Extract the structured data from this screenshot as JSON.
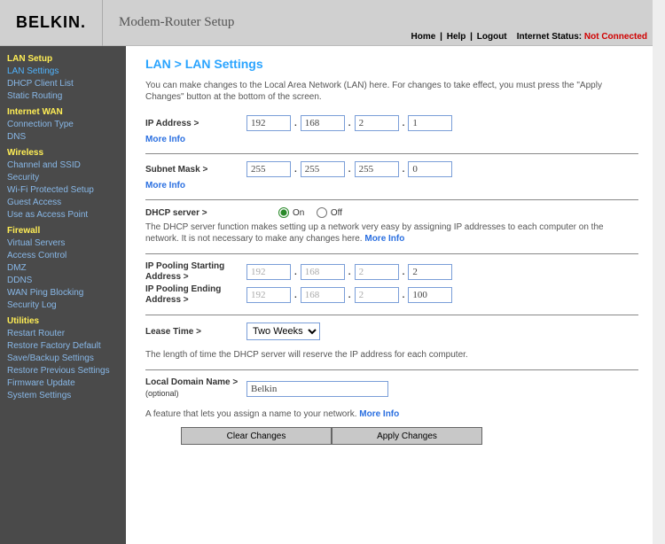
{
  "header": {
    "logo": "BELKIN",
    "product": "Modem-Router Setup",
    "nav": {
      "home": "Home",
      "help": "Help",
      "logout": "Logout"
    },
    "status_label": "Internet Status: ",
    "status_value": "Not Connected"
  },
  "sidebar": {
    "lan_setup": {
      "head": "LAN Setup",
      "items": [
        "LAN Settings",
        "DHCP Client List",
        "Static Routing"
      ]
    },
    "internet_wan": {
      "head": "Internet WAN",
      "items": [
        "Connection Type",
        "DNS"
      ]
    },
    "wireless": {
      "head": "Wireless",
      "items": [
        "Channel and SSID",
        "Security",
        "Wi-Fi Protected Setup",
        "Guest Access",
        "Use as Access Point"
      ]
    },
    "firewall": {
      "head": "Firewall",
      "items": [
        "Virtual Servers",
        "Access Control",
        "DMZ",
        "DDNS",
        "WAN Ping Blocking",
        "Security Log"
      ]
    },
    "utilities": {
      "head": "Utilities",
      "items": [
        "Restart Router",
        "Restore Factory Default",
        "Save/Backup Settings",
        "Restore Previous Settings",
        "Firmware Update",
        "System Settings"
      ]
    }
  },
  "main": {
    "breadcrumb": "LAN > LAN Settings",
    "intro": "You can make changes to the Local Area Network (LAN) here. For changes to take effect, you must press the \"Apply Changes\" button at the bottom of the screen.",
    "more_info": "More Info",
    "ip_address": {
      "label": "IP Address >",
      "octets": [
        "192",
        "168",
        "2",
        "1"
      ]
    },
    "subnet_mask": {
      "label": "Subnet Mask >",
      "octets": [
        "255",
        "255",
        "255",
        "0"
      ]
    },
    "dhcp": {
      "label": "DHCP server >",
      "on": "On",
      "off": "Off",
      "desc": "The DHCP server function makes setting up a network very easy by assigning IP addresses to each computer on the network. It is not necessary to make any changes here. "
    },
    "pool_start": {
      "label": "IP Pooling Starting Address >",
      "octets": [
        "192",
        "168",
        "2",
        "2"
      ]
    },
    "pool_end": {
      "label": "IP Pooling Ending Address >",
      "octets": [
        "192",
        "168",
        "2",
        "100"
      ]
    },
    "lease": {
      "label": "Lease Time >",
      "value": "Two Weeks",
      "desc": "The length of time the DHCP server will reserve the IP address for each computer."
    },
    "domain": {
      "label": "Local Domain Name >",
      "optional": "(optional)",
      "value": "Belkin",
      "desc": "A feature that lets you assign a name to your network. "
    },
    "buttons": {
      "clear": "Clear Changes",
      "apply": "Apply Changes"
    }
  }
}
